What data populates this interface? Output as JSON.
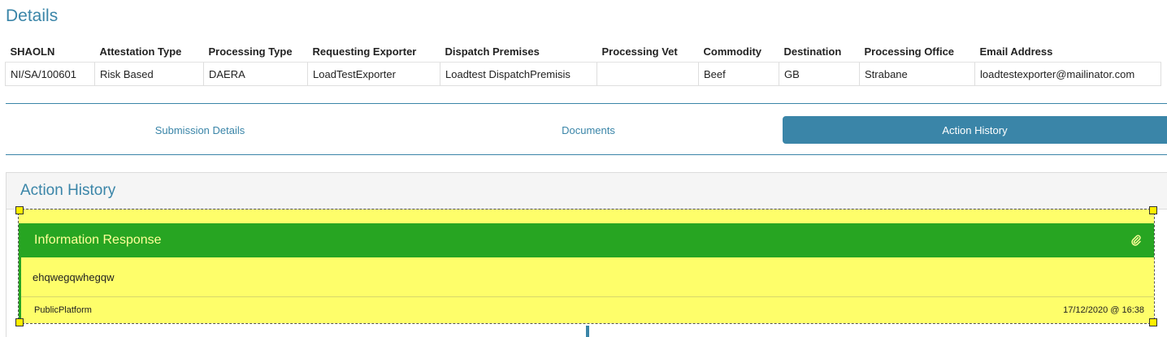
{
  "details": {
    "title": "Details",
    "columns": [
      "SHAOLN",
      "Attestation Type",
      "Processing Type",
      "Requesting Exporter",
      "Dispatch Premises",
      "Processing Vet",
      "Commodity",
      "Destination",
      "Processing Office",
      "Email Address"
    ],
    "row": [
      "NI/SA/100601",
      "Risk Based",
      "DAERA",
      "LoadTestExporter",
      "Loadtest DispatchPremisis",
      "",
      "Beef",
      "GB",
      "Strabane",
      "loadtestexporter@mailinator.com"
    ]
  },
  "tabs": [
    {
      "label": "Submission Details",
      "active": false
    },
    {
      "label": "Documents",
      "active": false
    },
    {
      "label": "Action History",
      "active": true
    }
  ],
  "action_history": {
    "title": "Action History",
    "entry": {
      "title": "Information Response",
      "icon": "paperclip-icon",
      "message": "ehqwegqwhegqw",
      "source": "PublicPlatform",
      "timestamp": "17/12/2020 @ 16:38"
    }
  },
  "colors": {
    "accent": "#3a85a8",
    "entry_header": "#27a522",
    "entry_header_text": "#ffff99",
    "highlight": "#fefe6a"
  }
}
